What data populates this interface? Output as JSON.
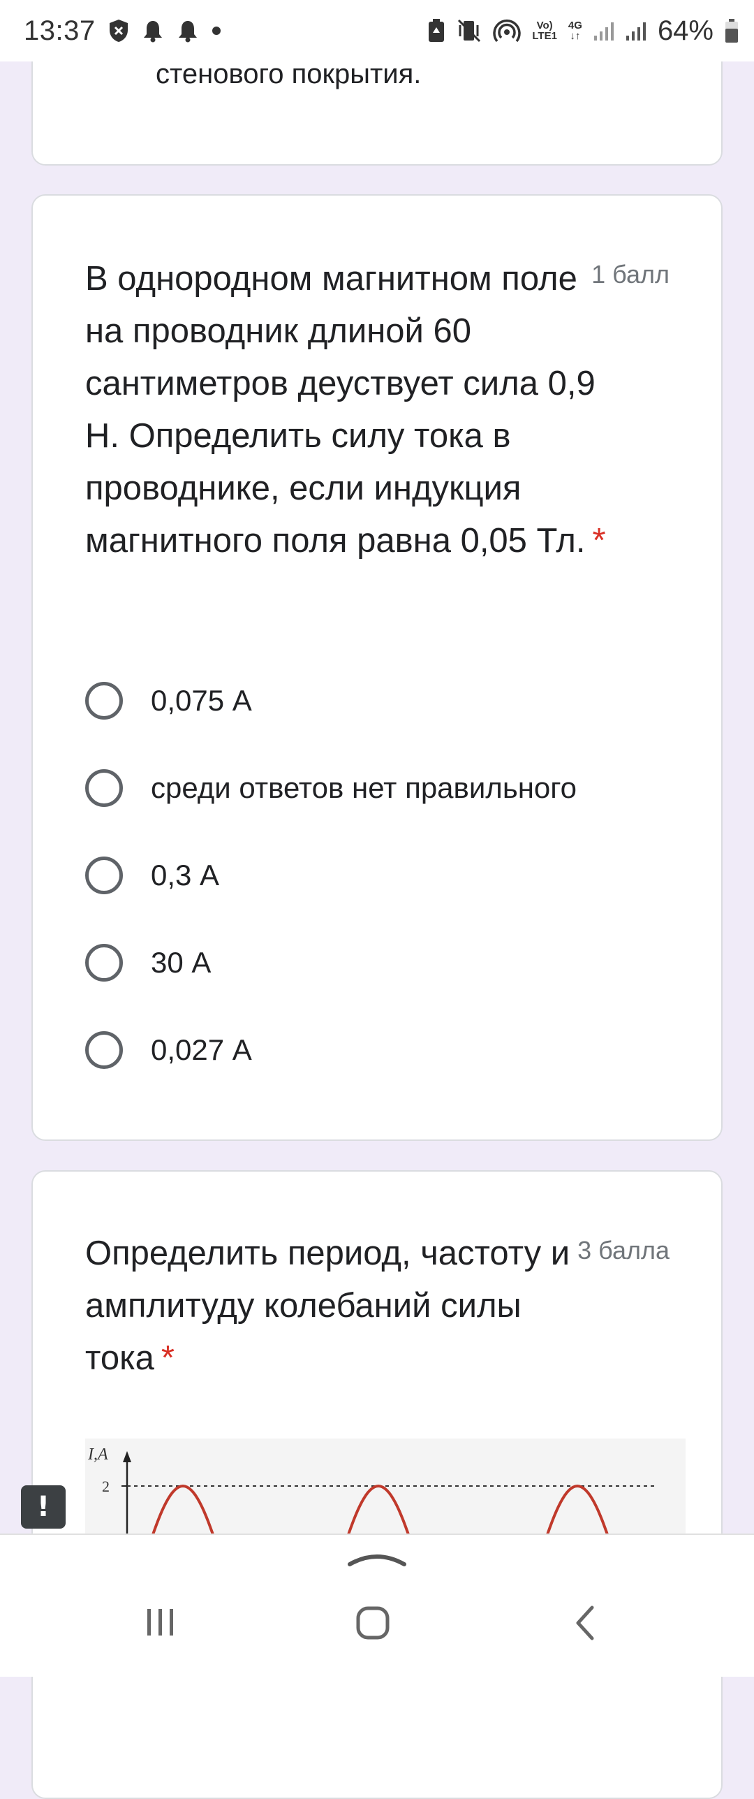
{
  "status_bar": {
    "time": "13:37",
    "volte_top": "Vo)",
    "volte_bottom": "LTE1",
    "network_top": "4G",
    "network_bottom": "↓↑",
    "battery_percent": "64%",
    "icons": [
      "vpn-shield-icon",
      "notification-bell-icon",
      "notification-bell-icon",
      "dot-icon",
      "battery-saver-icon",
      "vibrate-mute-icon",
      "hotspot-icon",
      "signal-icon",
      "signal-icon",
      "battery-icon"
    ]
  },
  "previous_card": {
    "text": "стенового покрытия."
  },
  "question1": {
    "title": "В однородном магнитном поле на проводник длиной 60 сантиметров деуствует сила 0,9 Н. Определить силу тока в проводнике, если индукция магнитного поля равна 0,05 Тл.",
    "required_marker": "*",
    "points": "1 балл",
    "options": [
      {
        "label": "0,075 А"
      },
      {
        "label": "среди ответов нет правильного"
      },
      {
        "label": "0,3 А"
      },
      {
        "label": "30 А"
      },
      {
        "label": "0,027 А"
      }
    ]
  },
  "question2": {
    "title": "Определить период, частоту и амплитуду колебаний силы тока",
    "required_marker": "*",
    "points": "3 балла",
    "chart_data": {
      "type": "line",
      "ylabel": "I,A",
      "y_ticks": [
        "2"
      ],
      "series_color": "#c0392b",
      "note": ""
    }
  },
  "report_button": {
    "label": "!"
  },
  "nav_bar": {
    "recent_icon": "recent-apps-icon",
    "home_icon": "home-icon",
    "back_icon": "back-icon"
  }
}
